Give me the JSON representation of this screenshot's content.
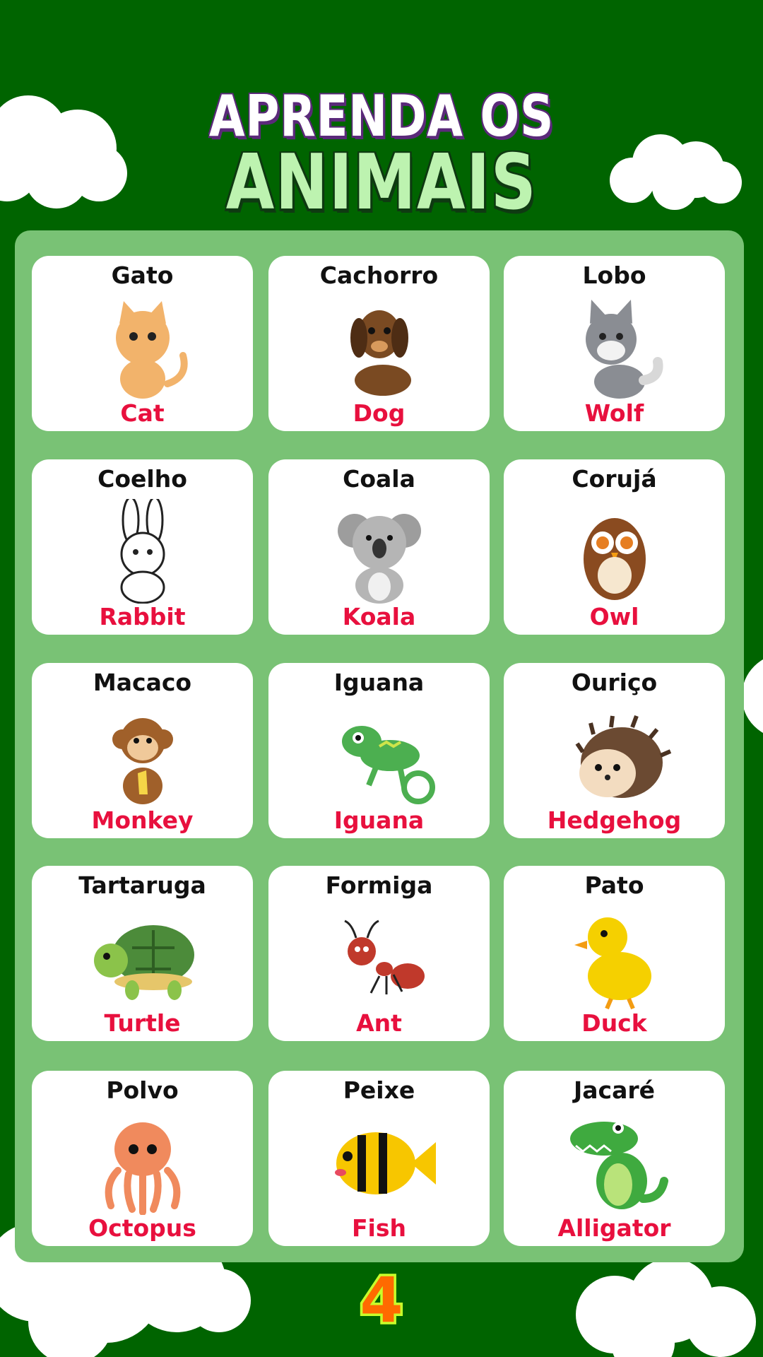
{
  "title": {
    "line1": "APRENDA OS",
    "line2": "ANIMAIS"
  },
  "cards": [
    {
      "pt": "Gato",
      "en": "Cat",
      "icon": "cat-icon"
    },
    {
      "pt": "Cachorro",
      "en": "Dog",
      "icon": "dog-icon"
    },
    {
      "pt": "Lobo",
      "en": "Wolf",
      "icon": "wolf-icon"
    },
    {
      "pt": "Coelho",
      "en": "Rabbit",
      "icon": "rabbit-icon"
    },
    {
      "pt": "Coala",
      "en": "Koala",
      "icon": "koala-icon"
    },
    {
      "pt": "Corujá",
      "en": "Owl",
      "icon": "owl-icon"
    },
    {
      "pt": "Macaco",
      "en": "Monkey",
      "icon": "monkey-icon"
    },
    {
      "pt": "Iguana",
      "en": "Iguana",
      "icon": "iguana-icon"
    },
    {
      "pt": "Ouriço",
      "en": "Hedgehog",
      "icon": "hedgehog-icon"
    },
    {
      "pt": "Tartaruga",
      "en": "Turtle",
      "icon": "turtle-icon"
    },
    {
      "pt": "Formiga",
      "en": "Ant",
      "icon": "ant-icon"
    },
    {
      "pt": "Pato",
      "en": "Duck",
      "icon": "duck-icon"
    },
    {
      "pt": "Polvo",
      "en": "Octopus",
      "icon": "octopus-icon"
    },
    {
      "pt": "Peixe",
      "en": "Fish",
      "icon": "fish-icon"
    },
    {
      "pt": "Jacaré",
      "en": "Alligator",
      "icon": "alligator-icon"
    }
  ],
  "page_number": "4",
  "colors": {
    "background": "#006400",
    "panel": "#79c275",
    "card": "#ffffff",
    "portuguese_text": "#111111",
    "english_text": "#e8103e",
    "title_line1": "#ffffff",
    "title_line2": "#bdf3b0",
    "page_number_fill": "#ff6a00",
    "page_number_outline": "#c8ff2a"
  }
}
